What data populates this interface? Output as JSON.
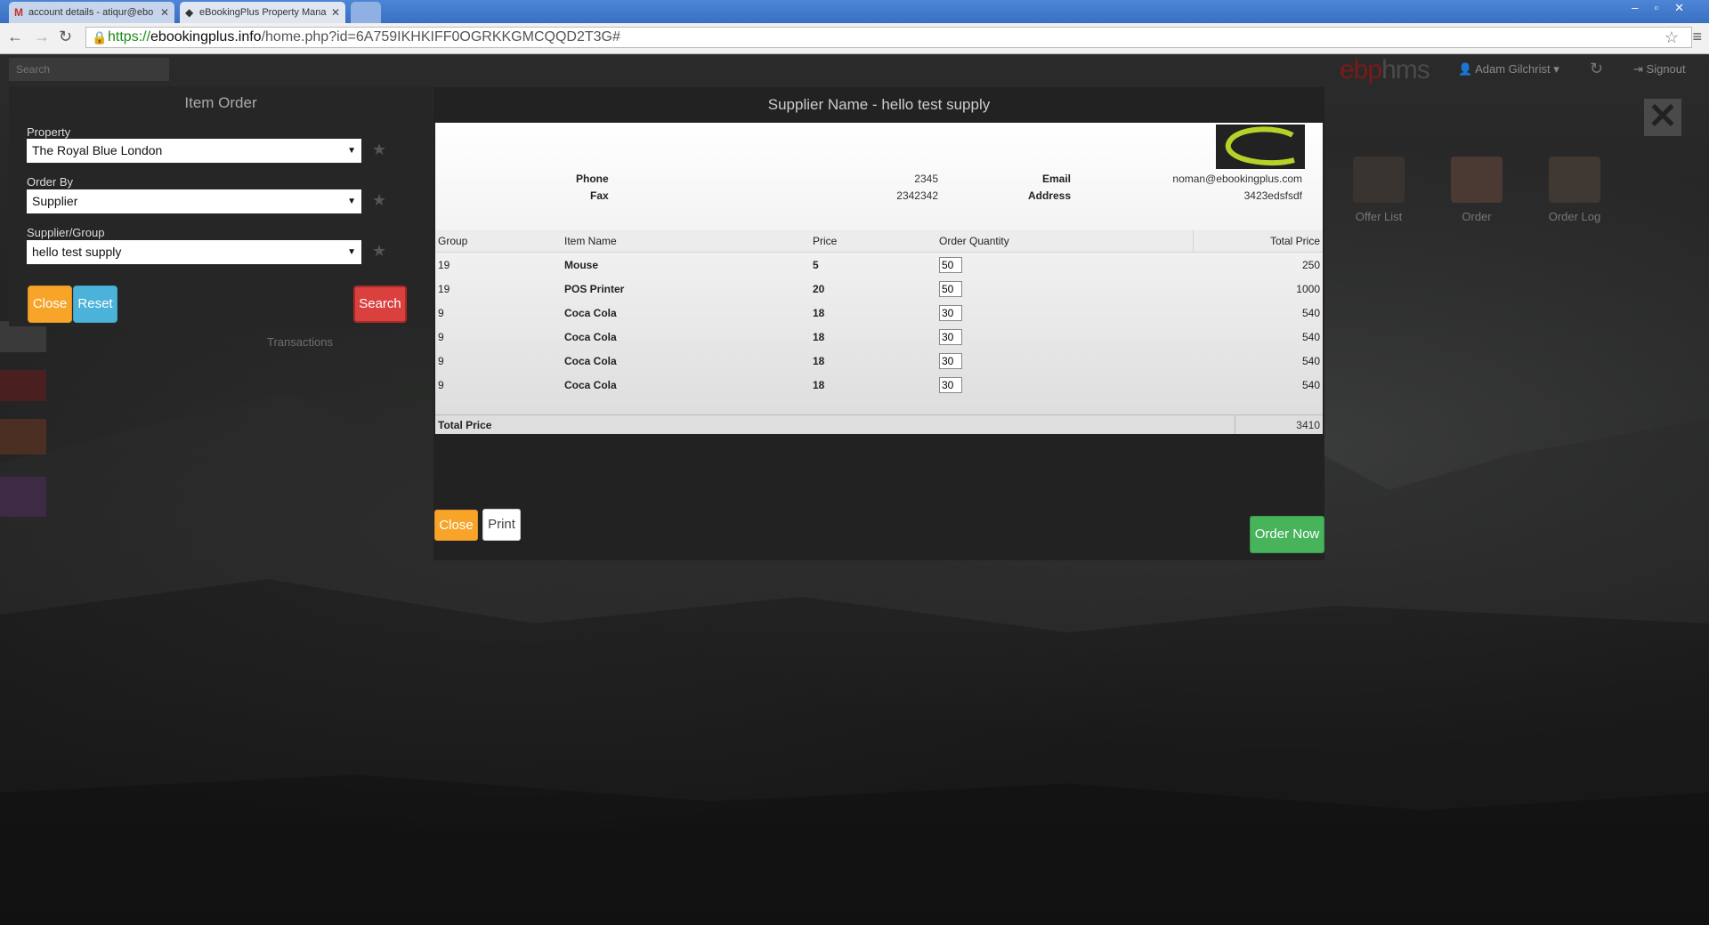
{
  "browser": {
    "tabs": [
      {
        "title": "account details - atiqur@ebo",
        "icon": "M"
      },
      {
        "title": "eBookingPlus Property Mana",
        "icon": "◆"
      }
    ],
    "url_protocol": "https://",
    "url_host": "ebookingplus.info",
    "url_path": "/home.php?id=6A759IKHKIFF0OGRKKGMCQQD2T3G#"
  },
  "topbar": {
    "search_placeholder": "Search",
    "brand_part1": "ebp",
    "brand_part2": "hms",
    "user": "Adam Gilchrist",
    "signout": "Signout"
  },
  "app_icons": [
    {
      "label": "Offer List"
    },
    {
      "label": "Order"
    },
    {
      "label": "Order Log"
    }
  ],
  "item_order": {
    "title": "Item Order",
    "property_label": "Property",
    "property_value": "The Royal Blue London",
    "order_by_label": "Order By",
    "order_by_value": "Supplier",
    "supplier_label": "Supplier/Group",
    "supplier_value": "hello test supply",
    "close_label": "Close",
    "reset_label": "Reset",
    "search_label": "Search",
    "transactions_label": "Transactions"
  },
  "modal": {
    "title": "Supplier Name - hello test supply",
    "phone_label": "Phone",
    "phone_value": "2345",
    "fax_label": "Fax",
    "fax_value": "2342342",
    "email_label": "Email",
    "email_value": "noman@ebookingplus.com",
    "address_label": "Address",
    "address_value": "3423edsfsdf",
    "columns": [
      "Group",
      "Item Name",
      "Price",
      "Order Quantity",
      "Total Price"
    ],
    "rows": [
      {
        "group": "19",
        "item": "Mouse",
        "price": "5",
        "qty": "50",
        "total": "250"
      },
      {
        "group": "19",
        "item": "POS Printer",
        "price": "20",
        "qty": "50",
        "total": "1000"
      },
      {
        "group": "9",
        "item": "Coca Cola",
        "price": "18",
        "qty": "30",
        "total": "540"
      },
      {
        "group": "9",
        "item": "Coca Cola",
        "price": "18",
        "qty": "30",
        "total": "540"
      },
      {
        "group": "9",
        "item": "Coca Cola",
        "price": "18",
        "qty": "30",
        "total": "540"
      },
      {
        "group": "9",
        "item": "Coca Cola",
        "price": "18",
        "qty": "30",
        "total": "540"
      }
    ],
    "total_label": "Total Price",
    "total_value": "3410",
    "close_label": "Close",
    "print_label": "Print",
    "order_now_label": "Order Now"
  },
  "colors": {
    "orange": "#f7a429",
    "blue": "#4bb3d9",
    "red": "#d9403e",
    "green": "#47b35a",
    "logo_green": "#b6d229"
  }
}
